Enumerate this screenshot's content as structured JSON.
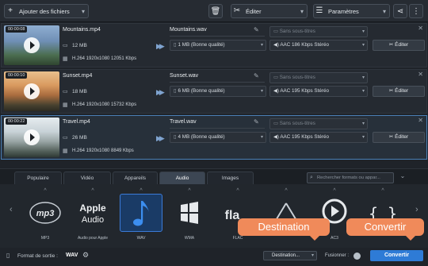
{
  "toolbar": {
    "add_files": "Ajouter des fichiers",
    "edit": "Éditer",
    "settings": "Paramètres"
  },
  "files": [
    {
      "duration": "00:00:08",
      "name": "Mountains.mp4",
      "size": "12 MB",
      "info": "H.264 1920x1080 12051 Kbps",
      "output_name": "Mountains.wav",
      "quality": "1 MB (Bonne qualité)",
      "subtitles": "Sans sous-titres",
      "audio": "AAC 186 Kbps Stéréo",
      "edit_label": "Éditer"
    },
    {
      "duration": "00:00:10",
      "name": "Sunset.mp4",
      "size": "18 MB",
      "info": "H.264 1920x1080 15732 Kbps",
      "output_name": "Sunset.wav",
      "quality": "6 MB (Bonne qualité)",
      "subtitles": "Sans sous-titres",
      "audio": "AAC 195 Kbps Stéréo",
      "edit_label": "Éditer"
    },
    {
      "duration": "00:00:22",
      "name": "Travel.mp4",
      "size": "26 MB",
      "info": "H.264 1920x1080 8849 Kbps",
      "output_name": "Travel.wav",
      "quality": "4 MB (Bonne qualité)",
      "subtitles": "Sans sous-titres",
      "audio": "AAC 195 Kbps Stéréo",
      "edit_label": "Éditer"
    }
  ],
  "format_tabs": [
    "Populaire",
    "Vidéo",
    "Appareils",
    "Audio",
    "Images"
  ],
  "active_tab": "Audio",
  "search_placeholder": "Rechercher formats ou appar...",
  "formats": [
    {
      "label": "MP3",
      "logo": "mp3",
      "selected": false
    },
    {
      "label": "Audio pour Apple",
      "logo": "Apple Audio",
      "selected": false
    },
    {
      "label": "WAV",
      "logo": "music-note",
      "selected": true
    },
    {
      "label": "WMA",
      "logo": "windows",
      "selected": false
    },
    {
      "label": "FLAC",
      "logo": "flac",
      "selected": false
    },
    {
      "label": "",
      "logo": "triangle",
      "selected": false
    },
    {
      "label": "AC3",
      "logo": "ac3",
      "selected": false
    },
    {
      "label": "",
      "logo": "braces",
      "selected": false
    }
  ],
  "callouts": {
    "destination": "Destination",
    "convert": "Convertir"
  },
  "bottom": {
    "output_format_label": "Format de sortie :",
    "output_format_value": "WAV",
    "destination_button": "Destination...",
    "merge_label": "Fusionner :",
    "convert_button": "Convertir"
  },
  "colors": {
    "accent": "#2e7bd6",
    "callout": "#f08a5a",
    "selected_border": "#4a7fb5"
  }
}
